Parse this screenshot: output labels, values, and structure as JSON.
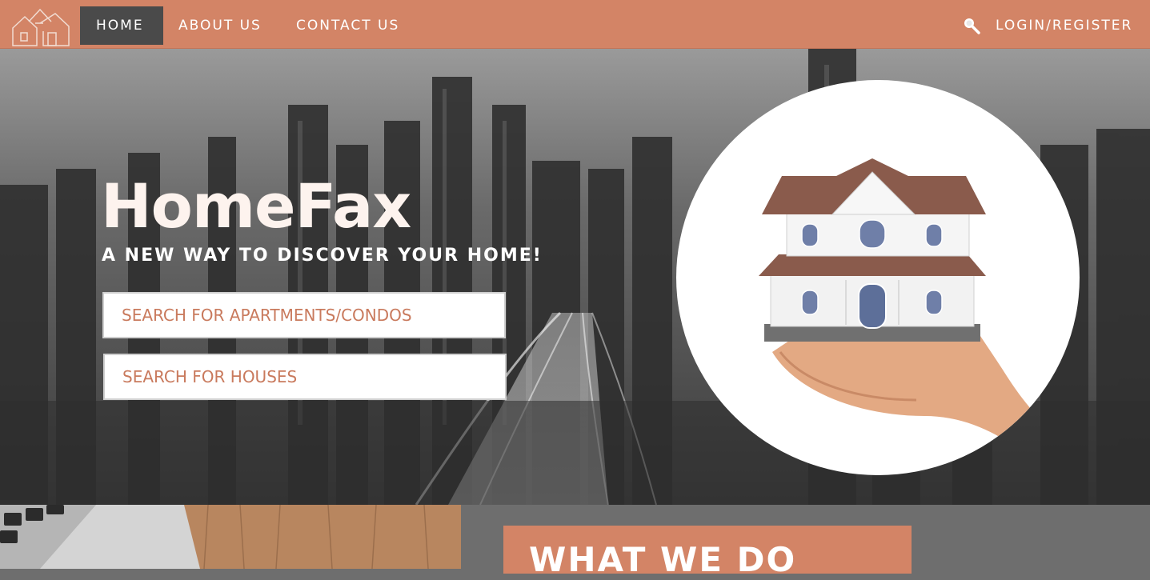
{
  "nav": {
    "home": "HOME",
    "about": "ABOUT US",
    "contact": "CONTACT US",
    "login": "LOGIN/REGISTER"
  },
  "hero": {
    "title": "HomeFax",
    "subtitle": "A NEW WAY TO DISCOVER YOUR HOME!",
    "search_apartments": "SEARCH FOR APARTMENTS/CONDOS",
    "search_houses": "SEARCH FOR HOUSES"
  },
  "section": {
    "what_we_do": "WHAT WE DO"
  },
  "icons": {
    "logo": "house-outline-logo",
    "search": "magnifier-icon"
  },
  "colors": {
    "brand": "#d38466",
    "nav_active": "#4a4a4a",
    "search_text": "#c97a5d"
  }
}
